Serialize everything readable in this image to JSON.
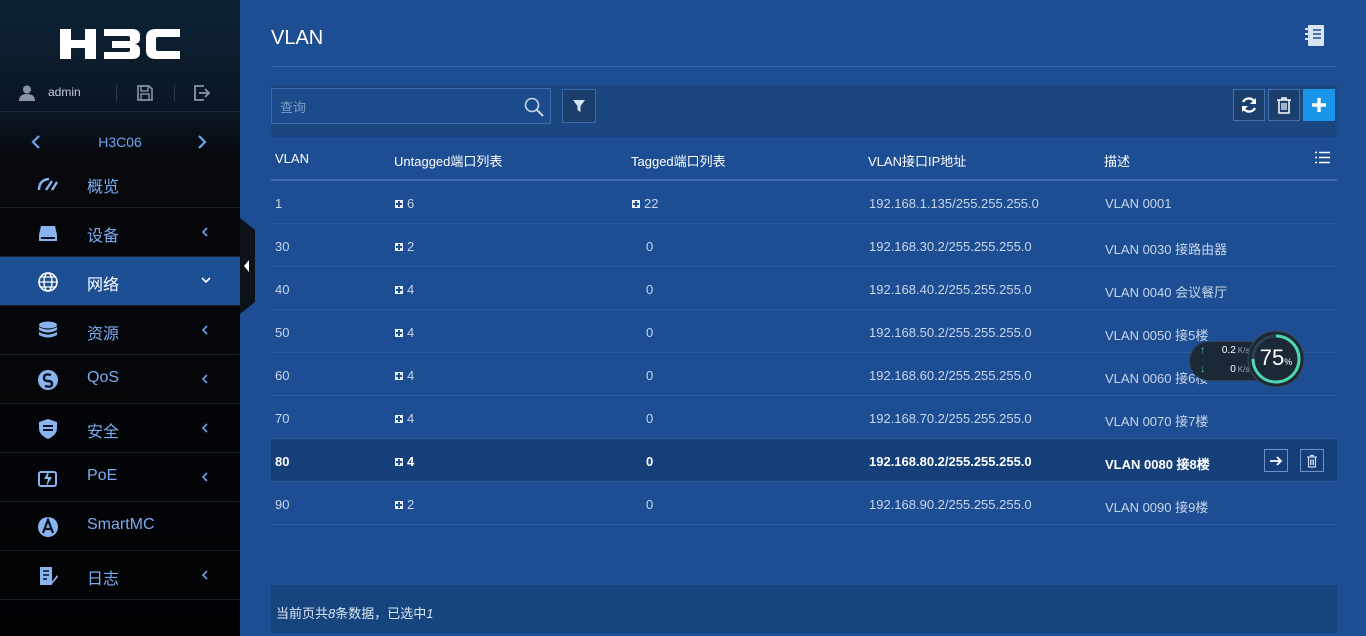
{
  "sidebar": {
    "logo_text": "H3C",
    "user": "admin",
    "device": "H3C06",
    "menu": [
      {
        "label": "概览",
        "icon": "dashboard-icon",
        "arrow": "none"
      },
      {
        "label": "设备",
        "icon": "device-icon",
        "arrow": "left"
      },
      {
        "label": "网络",
        "icon": "globe-icon",
        "arrow": "down"
      },
      {
        "label": "资源",
        "icon": "database-icon",
        "arrow": "left"
      },
      {
        "label": "QoS",
        "icon": "qos-icon",
        "arrow": "left"
      },
      {
        "label": "安全",
        "icon": "shield-icon",
        "arrow": "left"
      },
      {
        "label": "PoE",
        "icon": "poe-icon",
        "arrow": "left"
      },
      {
        "label": "SmartMC",
        "icon": "smartmc-icon",
        "arrow": "none"
      },
      {
        "label": "日志",
        "icon": "log-icon",
        "arrow": "left"
      }
    ],
    "active_index": 2
  },
  "main": {
    "title": "VLAN",
    "search_placeholder": "查询",
    "columns": [
      "VLAN",
      "Untagged端口列表",
      "Tagged端口列表",
      "VLAN接口IP地址",
      "描述"
    ],
    "rows": [
      {
        "vlan": "1",
        "untagged": "6",
        "tagged": "22",
        "tagged_expand": true,
        "ip": "192.168.1.135/255.255.255.0",
        "desc": "VLAN 0001"
      },
      {
        "vlan": "30",
        "untagged": "2",
        "tagged": "0",
        "tagged_expand": false,
        "ip": "192.168.30.2/255.255.255.0",
        "desc": "VLAN 0030 接路由器"
      },
      {
        "vlan": "40",
        "untagged": "4",
        "tagged": "0",
        "tagged_expand": false,
        "ip": "192.168.40.2/255.255.255.0",
        "desc": "VLAN 0040 会议餐厅"
      },
      {
        "vlan": "50",
        "untagged": "4",
        "tagged": "0",
        "tagged_expand": false,
        "ip": "192.168.50.2/255.255.255.0",
        "desc": "VLAN 0050 接5楼"
      },
      {
        "vlan": "60",
        "untagged": "4",
        "tagged": "0",
        "tagged_expand": false,
        "ip": "192.168.60.2/255.255.255.0",
        "desc": "VLAN 0060 接6楼"
      },
      {
        "vlan": "70",
        "untagged": "4",
        "tagged": "0",
        "tagged_expand": false,
        "ip": "192.168.70.2/255.255.255.0",
        "desc": "VLAN 0070 接7楼"
      },
      {
        "vlan": "80",
        "untagged": "4",
        "tagged": "0",
        "tagged_expand": false,
        "ip": "192.168.80.2/255.255.255.0",
        "desc": "VLAN 0080 接8楼",
        "selected": true
      },
      {
        "vlan": "90",
        "untagged": "2",
        "tagged": "0",
        "tagged_expand": false,
        "ip": "192.168.90.2/255.255.255.0",
        "desc": "VLAN 0090 接9楼"
      }
    ],
    "footer": {
      "prefix": "当前页共",
      "count": "8",
      "middle": "条数据，已选中",
      "selected": "1"
    }
  },
  "speed_widget": {
    "upload": "0.2",
    "download": "0",
    "unit": "K/s",
    "percent": "75",
    "percent_sign": "%",
    "percent_value": 0.75
  },
  "colors": {
    "background": "#1d4e93",
    "sidebar": "#06080c",
    "accent_blue": "#1a95e8",
    "menu_text": "#7cacf0",
    "gauge": "#4fd8b0"
  }
}
